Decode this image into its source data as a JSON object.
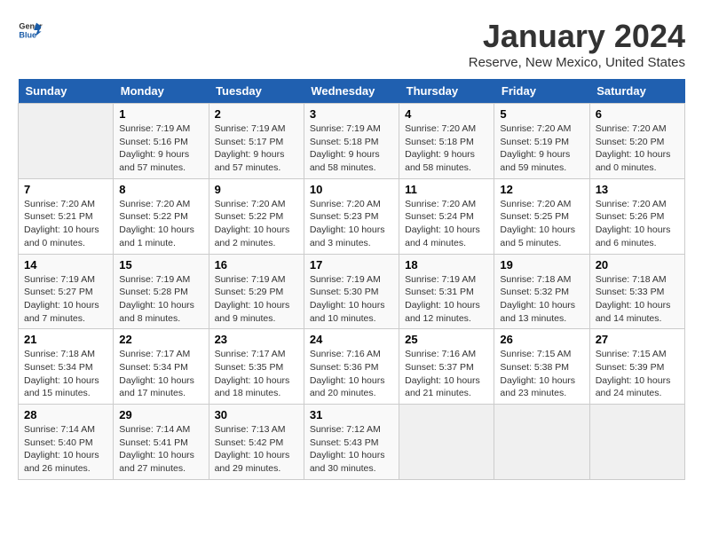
{
  "logo": {
    "text_general": "General",
    "text_blue": "Blue"
  },
  "title": "January 2024",
  "subtitle": "Reserve, New Mexico, United States",
  "days_of_week": [
    "Sunday",
    "Monday",
    "Tuesday",
    "Wednesday",
    "Thursday",
    "Friday",
    "Saturday"
  ],
  "weeks": [
    [
      {
        "day": "",
        "info": ""
      },
      {
        "day": "1",
        "info": "Sunrise: 7:19 AM\nSunset: 5:16 PM\nDaylight: 9 hours\nand 57 minutes."
      },
      {
        "day": "2",
        "info": "Sunrise: 7:19 AM\nSunset: 5:17 PM\nDaylight: 9 hours\nand 57 minutes."
      },
      {
        "day": "3",
        "info": "Sunrise: 7:19 AM\nSunset: 5:18 PM\nDaylight: 9 hours\nand 58 minutes."
      },
      {
        "day": "4",
        "info": "Sunrise: 7:20 AM\nSunset: 5:18 PM\nDaylight: 9 hours\nand 58 minutes."
      },
      {
        "day": "5",
        "info": "Sunrise: 7:20 AM\nSunset: 5:19 PM\nDaylight: 9 hours\nand 59 minutes."
      },
      {
        "day": "6",
        "info": "Sunrise: 7:20 AM\nSunset: 5:20 PM\nDaylight: 10 hours\nand 0 minutes."
      }
    ],
    [
      {
        "day": "7",
        "info": "Sunrise: 7:20 AM\nSunset: 5:21 PM\nDaylight: 10 hours\nand 0 minutes."
      },
      {
        "day": "8",
        "info": "Sunrise: 7:20 AM\nSunset: 5:22 PM\nDaylight: 10 hours\nand 1 minute."
      },
      {
        "day": "9",
        "info": "Sunrise: 7:20 AM\nSunset: 5:22 PM\nDaylight: 10 hours\nand 2 minutes."
      },
      {
        "day": "10",
        "info": "Sunrise: 7:20 AM\nSunset: 5:23 PM\nDaylight: 10 hours\nand 3 minutes."
      },
      {
        "day": "11",
        "info": "Sunrise: 7:20 AM\nSunset: 5:24 PM\nDaylight: 10 hours\nand 4 minutes."
      },
      {
        "day": "12",
        "info": "Sunrise: 7:20 AM\nSunset: 5:25 PM\nDaylight: 10 hours\nand 5 minutes."
      },
      {
        "day": "13",
        "info": "Sunrise: 7:20 AM\nSunset: 5:26 PM\nDaylight: 10 hours\nand 6 minutes."
      }
    ],
    [
      {
        "day": "14",
        "info": "Sunrise: 7:19 AM\nSunset: 5:27 PM\nDaylight: 10 hours\nand 7 minutes."
      },
      {
        "day": "15",
        "info": "Sunrise: 7:19 AM\nSunset: 5:28 PM\nDaylight: 10 hours\nand 8 minutes."
      },
      {
        "day": "16",
        "info": "Sunrise: 7:19 AM\nSunset: 5:29 PM\nDaylight: 10 hours\nand 9 minutes."
      },
      {
        "day": "17",
        "info": "Sunrise: 7:19 AM\nSunset: 5:30 PM\nDaylight: 10 hours\nand 10 minutes."
      },
      {
        "day": "18",
        "info": "Sunrise: 7:19 AM\nSunset: 5:31 PM\nDaylight: 10 hours\nand 12 minutes."
      },
      {
        "day": "19",
        "info": "Sunrise: 7:18 AM\nSunset: 5:32 PM\nDaylight: 10 hours\nand 13 minutes."
      },
      {
        "day": "20",
        "info": "Sunrise: 7:18 AM\nSunset: 5:33 PM\nDaylight: 10 hours\nand 14 minutes."
      }
    ],
    [
      {
        "day": "21",
        "info": "Sunrise: 7:18 AM\nSunset: 5:34 PM\nDaylight: 10 hours\nand 15 minutes."
      },
      {
        "day": "22",
        "info": "Sunrise: 7:17 AM\nSunset: 5:34 PM\nDaylight: 10 hours\nand 17 minutes."
      },
      {
        "day": "23",
        "info": "Sunrise: 7:17 AM\nSunset: 5:35 PM\nDaylight: 10 hours\nand 18 minutes."
      },
      {
        "day": "24",
        "info": "Sunrise: 7:16 AM\nSunset: 5:36 PM\nDaylight: 10 hours\nand 20 minutes."
      },
      {
        "day": "25",
        "info": "Sunrise: 7:16 AM\nSunset: 5:37 PM\nDaylight: 10 hours\nand 21 minutes."
      },
      {
        "day": "26",
        "info": "Sunrise: 7:15 AM\nSunset: 5:38 PM\nDaylight: 10 hours\nand 23 minutes."
      },
      {
        "day": "27",
        "info": "Sunrise: 7:15 AM\nSunset: 5:39 PM\nDaylight: 10 hours\nand 24 minutes."
      }
    ],
    [
      {
        "day": "28",
        "info": "Sunrise: 7:14 AM\nSunset: 5:40 PM\nDaylight: 10 hours\nand 26 minutes."
      },
      {
        "day": "29",
        "info": "Sunrise: 7:14 AM\nSunset: 5:41 PM\nDaylight: 10 hours\nand 27 minutes."
      },
      {
        "day": "30",
        "info": "Sunrise: 7:13 AM\nSunset: 5:42 PM\nDaylight: 10 hours\nand 29 minutes."
      },
      {
        "day": "31",
        "info": "Sunrise: 7:12 AM\nSunset: 5:43 PM\nDaylight: 10 hours\nand 30 minutes."
      },
      {
        "day": "",
        "info": ""
      },
      {
        "day": "",
        "info": ""
      },
      {
        "day": "",
        "info": ""
      }
    ]
  ]
}
